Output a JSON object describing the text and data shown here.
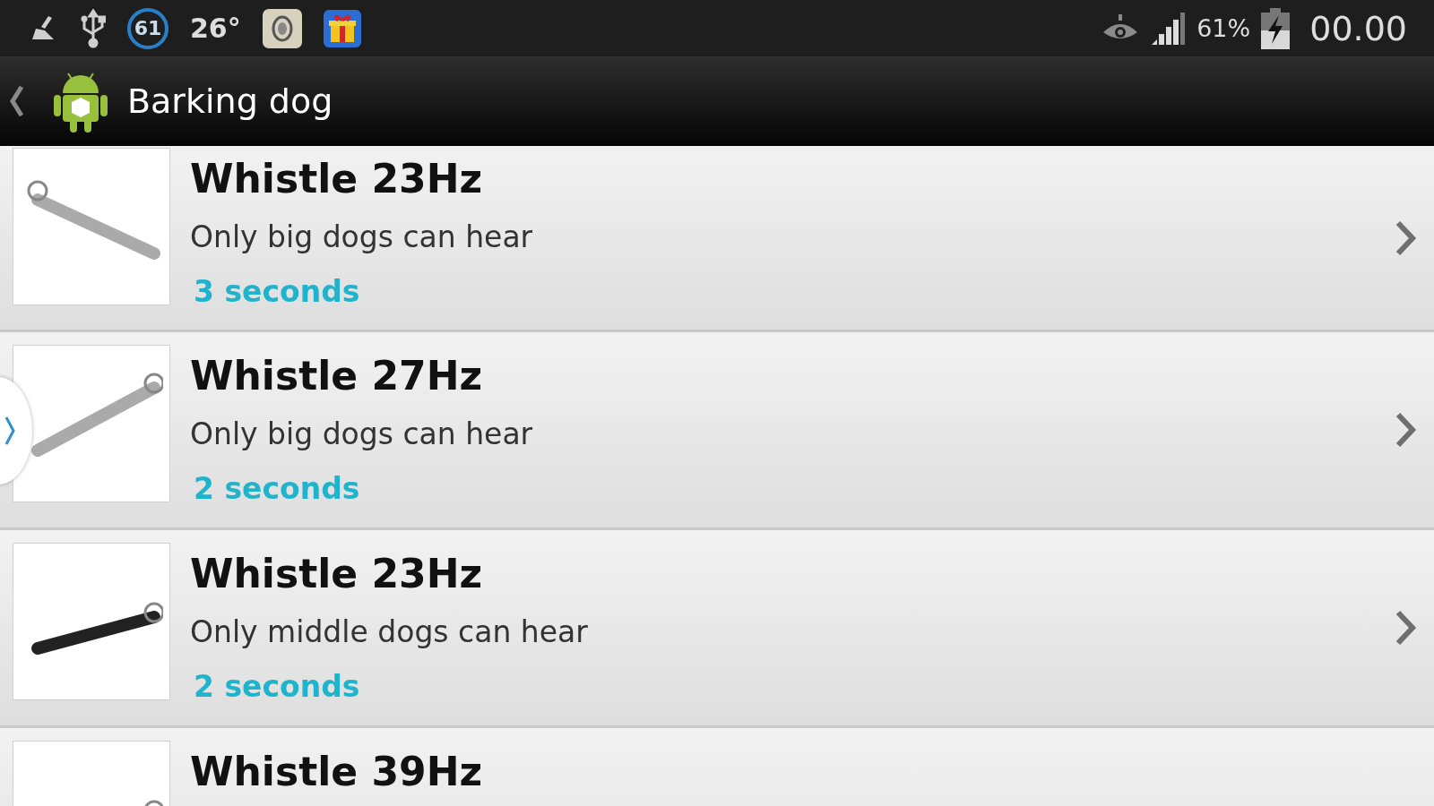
{
  "status_bar": {
    "battery_ring": "61",
    "temperature": "26°",
    "signal_percent": "61%",
    "time": "00.00"
  },
  "action_bar": {
    "title": "Barking dog"
  },
  "items": [
    {
      "title": "Whistle 23Hz",
      "subtitle": "Only big dogs can hear",
      "duration": "3 seconds"
    },
    {
      "title": "Whistle 27Hz",
      "subtitle": "Only big dogs can hear",
      "duration": "2 seconds"
    },
    {
      "title": "Whistle 23Hz",
      "subtitle": "Only middle dogs can hear",
      "duration": "2 seconds"
    },
    {
      "title": "Whistle 39Hz"
    }
  ]
}
